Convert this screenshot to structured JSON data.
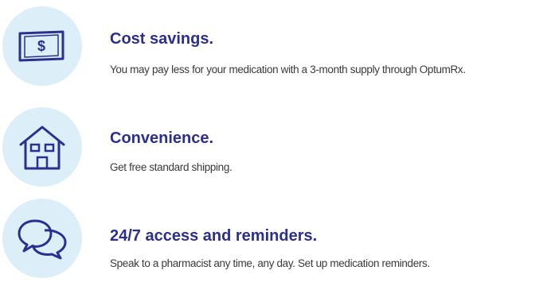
{
  "colors": {
    "title": "#2b2f8e",
    "icon_stroke": "#2b2f8e",
    "icon_bg": "#dceef8",
    "body_text": "#3a3a3a"
  },
  "benefits": [
    {
      "icon": "dollar-bill-icon",
      "icon_glyph": "$",
      "title": "Cost savings.",
      "description": "You may pay less for your medication with a 3-month supply through OptumRx."
    },
    {
      "icon": "house-icon",
      "title": "Convenience.",
      "description": "Get free standard shipping."
    },
    {
      "icon": "chat-bubbles-icon",
      "title": "24/7 access and reminders.",
      "description": "Speak to a pharmacist any time, any day. Set up medication reminders."
    }
  ]
}
